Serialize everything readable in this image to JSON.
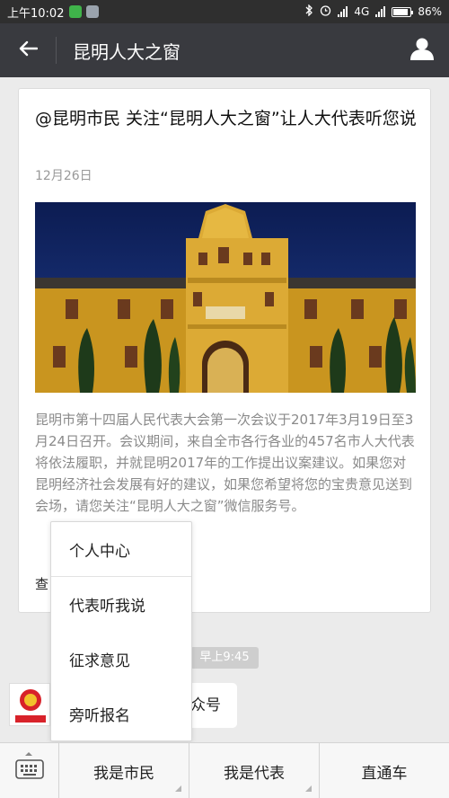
{
  "status_bar": {
    "time": "上午10:02",
    "network": "4G",
    "battery": "86%",
    "battery_level": 0.86
  },
  "header": {
    "title": "昆明人大之窗",
    "back_icon": "arrow-left-icon",
    "profile_icon": "person-icon"
  },
  "article": {
    "title": "@昆明市民 关注“昆明人大之窗”让人大代表听您说",
    "date": "12月26日",
    "summary": "昆明市第十四届人民代表大会第一次会议于2017年3月19日至3月24日召开。会议期间，来自全市各行各业的457名市人大代表将依法履职，并就昆明2017年的工作提出议案建议。如果您对昆明经济社会发展有好的建议，如果您希望将您的宝贵意见送到会场，请您关注“昆明人大之窗”微信服务号。",
    "more_link": "查"
  },
  "timestamp": "早上9:45",
  "message": {
    "text": "众号",
    "avatar_label": "昆明人大之窗"
  },
  "popup_menu": {
    "items": [
      "个人中心",
      "代表听我说",
      "征求意见",
      "旁听报名"
    ]
  },
  "bottom_bar": {
    "keyboard_icon": "keyboard-icon",
    "menus": [
      "我是市民",
      "我是代表",
      "直通车"
    ]
  },
  "colors": {
    "header_bg": "#393a3f",
    "building": "#d9a62e",
    "sky": "#10235e"
  }
}
